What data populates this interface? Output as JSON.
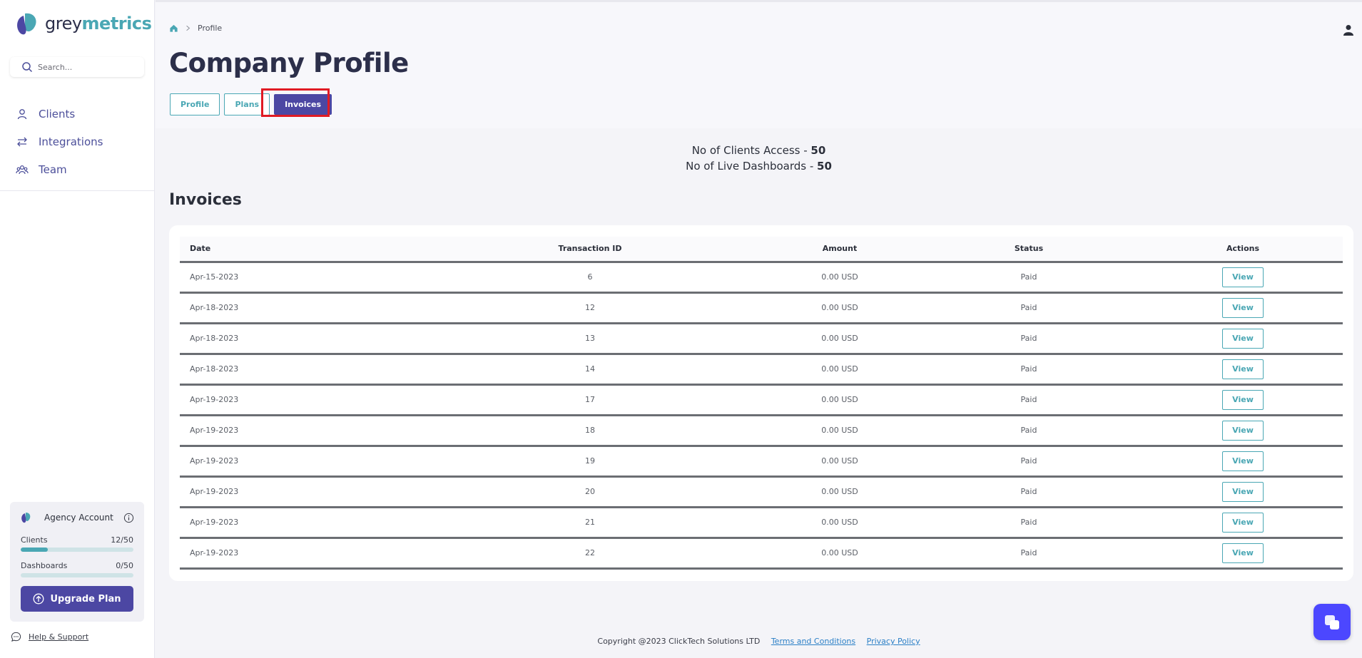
{
  "brand": {
    "grey": "grey",
    "metrics": "metrics"
  },
  "search": {
    "placeholder": "Search..."
  },
  "nav": {
    "items": [
      {
        "label": "Clients"
      },
      {
        "label": "Integrations"
      },
      {
        "label": "Team"
      }
    ]
  },
  "account": {
    "title": "Agency Account",
    "clients_label": "Clients",
    "clients_value": "12/50",
    "clients_fraction": 0.24,
    "dashboards_label": "Dashboards",
    "dashboards_value": "0/50",
    "dashboards_fraction": 0,
    "upgrade_label": "Upgrade Plan"
  },
  "help": {
    "label": "Help & Support"
  },
  "breadcrumb": {
    "current": "Profile"
  },
  "page": {
    "title": "Company Profile"
  },
  "tabs": [
    {
      "label": "Profile"
    },
    {
      "label": "Plans"
    },
    {
      "label": "Invoices",
      "active": true
    }
  ],
  "stats": {
    "clients_access_label": "No of Clients Access - ",
    "clients_access_value": "50",
    "live_dashboards_label": "No of Live Dashboards - ",
    "live_dashboards_value": "50"
  },
  "invoices": {
    "title": "Invoices",
    "columns": [
      "Date",
      "Transaction ID",
      "Amount",
      "Status",
      "Actions"
    ],
    "view_label": "View",
    "rows": [
      {
        "date": "Apr-15-2023",
        "id": "6",
        "amount": "0.00 USD",
        "status": "Paid"
      },
      {
        "date": "Apr-18-2023",
        "id": "12",
        "amount": "0.00 USD",
        "status": "Paid"
      },
      {
        "date": "Apr-18-2023",
        "id": "13",
        "amount": "0.00 USD",
        "status": "Paid"
      },
      {
        "date": "Apr-18-2023",
        "id": "14",
        "amount": "0.00 USD",
        "status": "Paid"
      },
      {
        "date": "Apr-19-2023",
        "id": "17",
        "amount": "0.00 USD",
        "status": "Paid"
      },
      {
        "date": "Apr-19-2023",
        "id": "18",
        "amount": "0.00 USD",
        "status": "Paid"
      },
      {
        "date": "Apr-19-2023",
        "id": "19",
        "amount": "0.00 USD",
        "status": "Paid"
      },
      {
        "date": "Apr-19-2023",
        "id": "20",
        "amount": "0.00 USD",
        "status": "Paid"
      },
      {
        "date": "Apr-19-2023",
        "id": "21",
        "amount": "0.00 USD",
        "status": "Paid"
      },
      {
        "date": "Apr-19-2023",
        "id": "22",
        "amount": "0.00 USD",
        "status": "Paid"
      }
    ]
  },
  "footer": {
    "copyright": "Copyright @2023 ClickTech Solutions LTD",
    "terms": "Terms and Conditions",
    "privacy": "Privacy Policy"
  },
  "colors": {
    "accent": "#4aa7b4",
    "primary": "#4c47a3",
    "highlight": "#e01b24",
    "chat": "#4c47ff"
  }
}
